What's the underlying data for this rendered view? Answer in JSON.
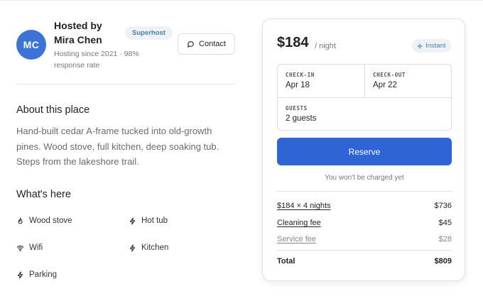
{
  "host": {
    "initials": "MC",
    "name": "Hosted by Mira Chen",
    "badge": "Superhost",
    "meta": "Hosting since 2021 · 98% response rate",
    "contact_label": "Contact"
  },
  "about": {
    "title": "About this place",
    "text": "Hand-built cedar A-frame tucked into old-growth pines. Wood stove, full kitchen, deep soaking tub. Steps from the lakeshore trail."
  },
  "amenities": {
    "title": "What's here",
    "items": [
      {
        "label": "Wood stove",
        "icon": "flame-icon"
      },
      {
        "label": "Hot tub",
        "icon": "bolt-icon"
      },
      {
        "label": "Wifi",
        "icon": "wifi-icon"
      },
      {
        "label": "Kitchen",
        "icon": "bolt-icon"
      },
      {
        "label": "Parking",
        "icon": "bolt-icon"
      }
    ]
  },
  "booking": {
    "price": "$184",
    "per_night": "/ night",
    "instant_label": "Instant",
    "checkin_label": "CHECK-IN",
    "checkin_value": "Apr 18",
    "checkout_label": "CHECK-OUT",
    "checkout_value": "Apr 22",
    "guests_label": "GUESTS",
    "guests_value": "2 guests",
    "reserve_label": "Reserve",
    "no_charge_note": "You won't be charged yet",
    "line_items": [
      {
        "label": "$184 × 4 nights",
        "amount": "$736"
      },
      {
        "label": "Cleaning fee",
        "amount": "$45"
      },
      {
        "label": "Service fee",
        "amount": "$28"
      }
    ],
    "total_label": "Total",
    "total_amount": "$809"
  },
  "colors": {
    "accent": "#2f64d4",
    "avatar": "#3b73d9",
    "badge_text": "#4a7fa8",
    "badge_bg": "#eef2f6"
  }
}
